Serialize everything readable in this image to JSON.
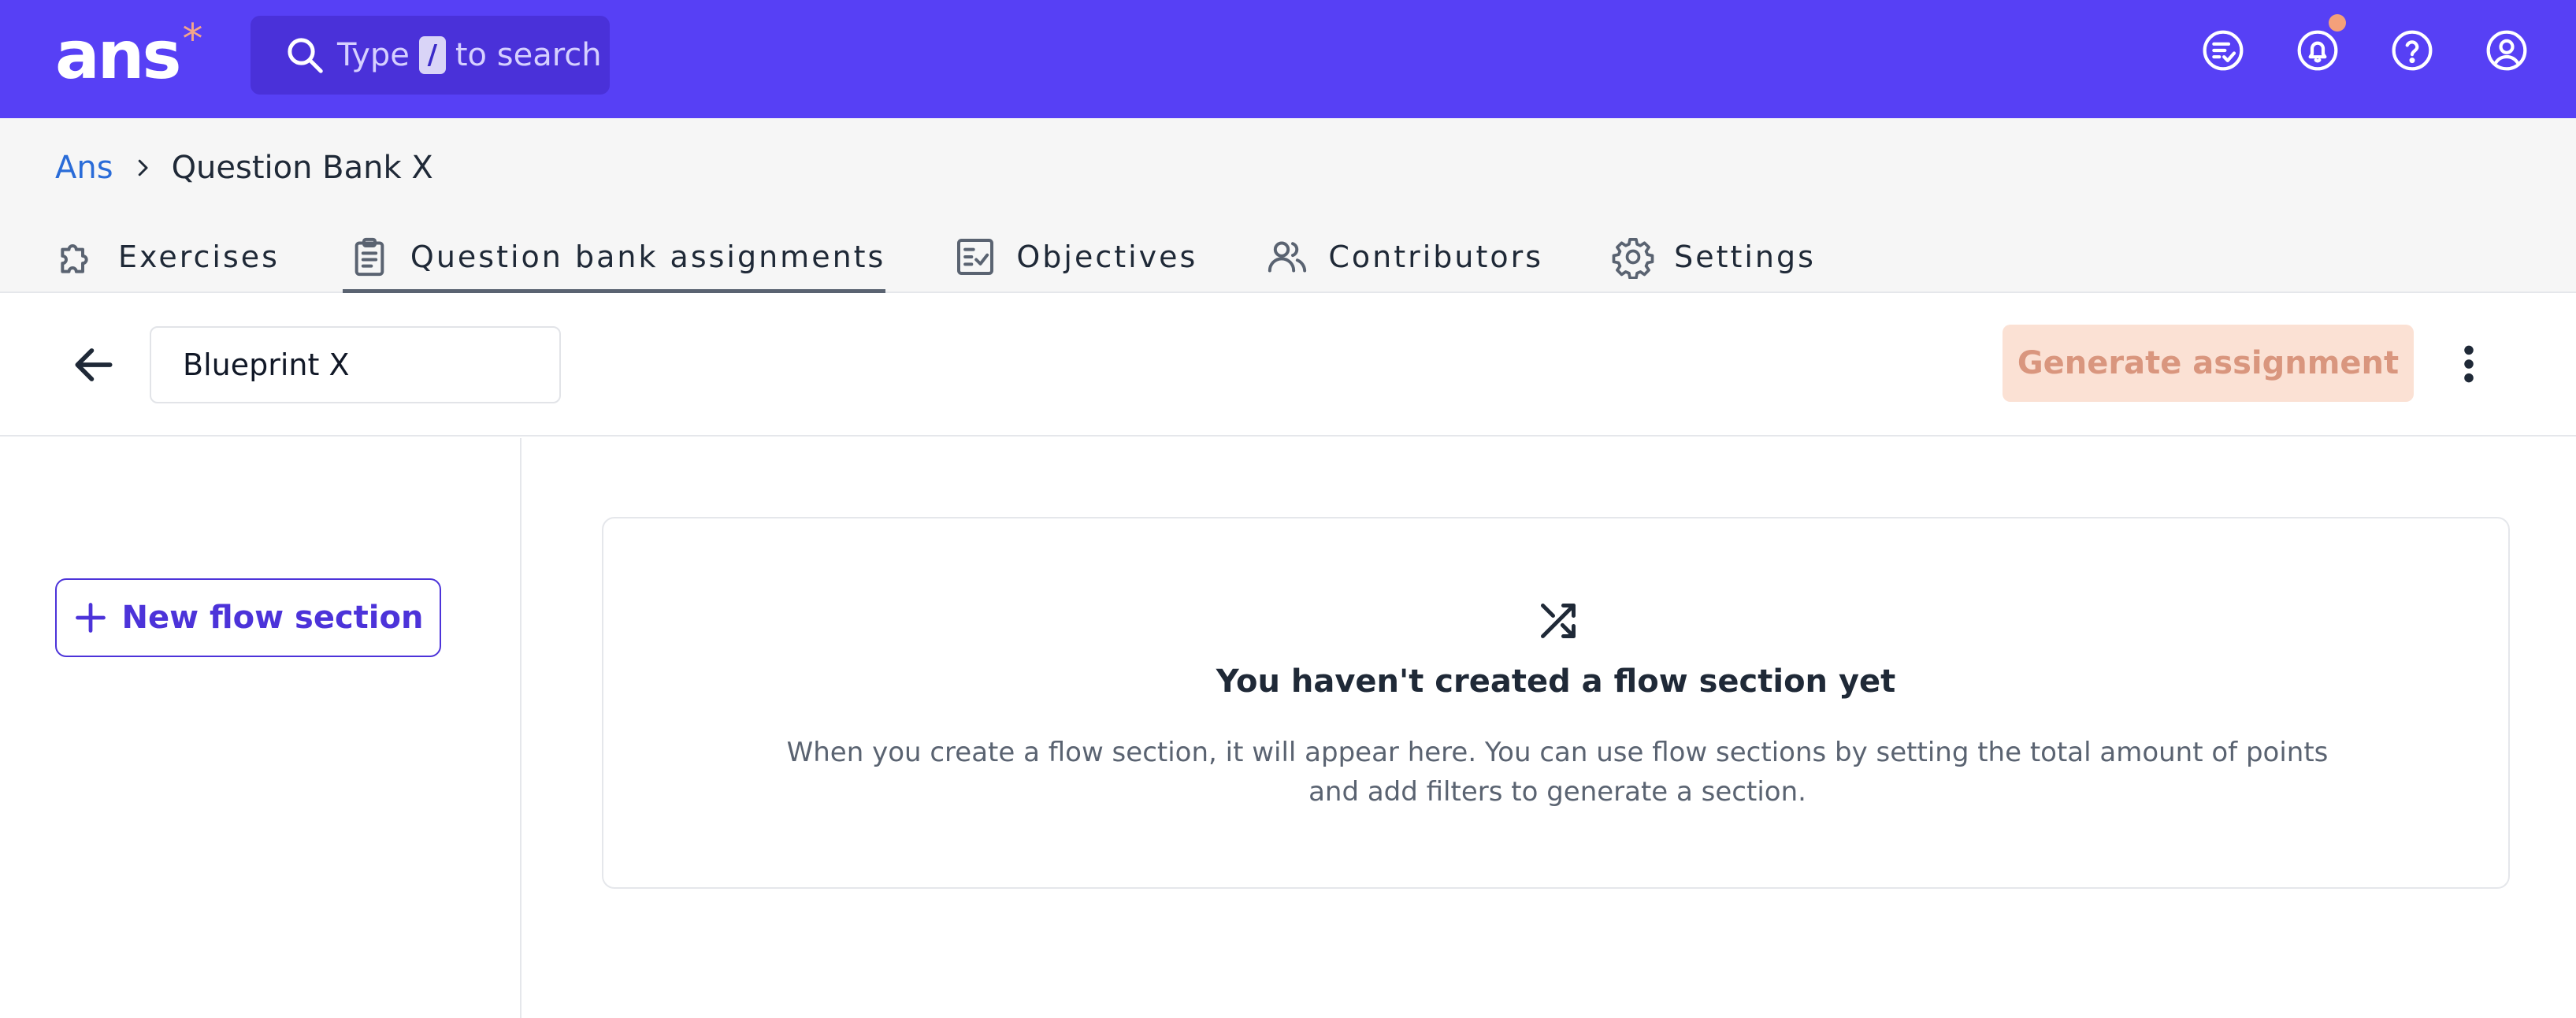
{
  "topbar": {
    "logo_text": "ans",
    "logo_star": "*",
    "search": {
      "prefix": "Type",
      "key": "/",
      "suffix": "to search"
    },
    "icons": [
      "task-list-icon",
      "bell-icon",
      "help-icon",
      "user-icon"
    ],
    "accent_color": "#5740f5",
    "notification_dot_color": "#f4a07a"
  },
  "breadcrumb": {
    "root": "Ans",
    "current": "Question Bank X"
  },
  "tabs": [
    {
      "label": "Exercises",
      "icon": "puzzle-icon"
    },
    {
      "label": "Question bank assignments",
      "icon": "clipboard-icon",
      "active": true
    },
    {
      "label": "Objectives",
      "icon": "checklist-icon"
    },
    {
      "label": "Contributors",
      "icon": "users-icon"
    },
    {
      "label": "Settings",
      "icon": "gear-icon"
    }
  ],
  "toolbar": {
    "blueprint_name": "Blueprint X",
    "generate_label": "Generate assignment"
  },
  "sidebar": {
    "new_flow_label": "New flow section"
  },
  "empty_state": {
    "icon": "shuffle-icon",
    "title": "You haven't created a flow section yet",
    "description": "When you create a flow section, it will appear here. You can use flow sections by setting the total amount of points and add filters to generate a section."
  }
}
